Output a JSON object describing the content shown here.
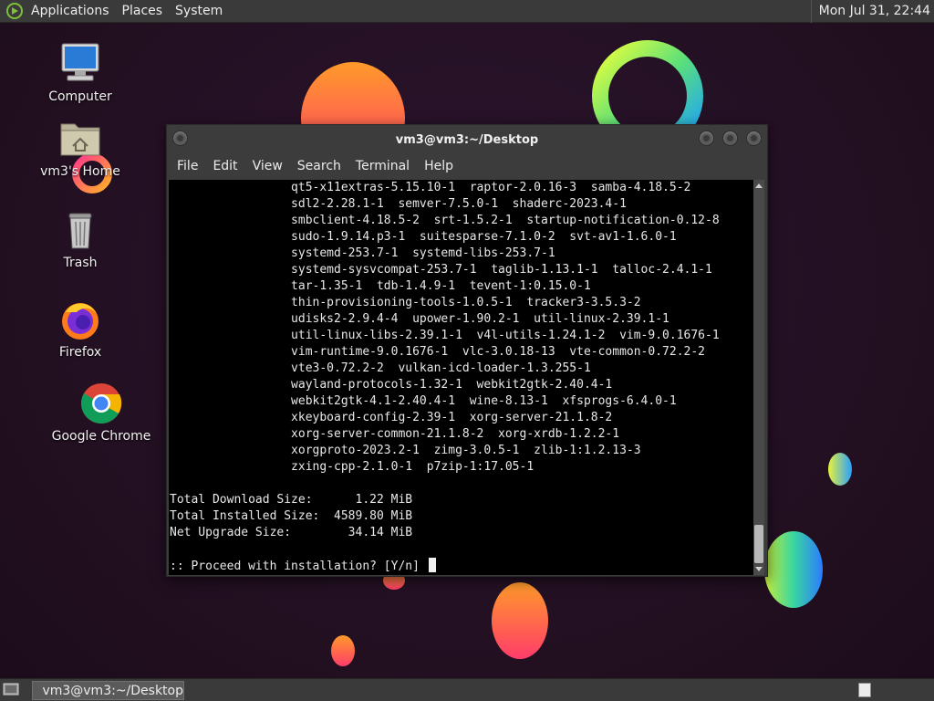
{
  "top_panel": {
    "menus": [
      "Applications",
      "Places",
      "System"
    ],
    "clock": "Mon Jul 31, 22:44"
  },
  "desktop_icons": [
    {
      "label": "Computer",
      "icon": "computer-icon"
    },
    {
      "label": "vm3's Home",
      "icon": "home-folder-icon"
    },
    {
      "label": "Trash",
      "icon": "trash-icon"
    },
    {
      "label": "Firefox",
      "icon": "firefox-icon"
    },
    {
      "label": "Google Chrome",
      "icon": "chrome-icon"
    }
  ],
  "terminal": {
    "title": "vm3@vm3:~/Desktop",
    "menu": [
      "File",
      "Edit",
      "View",
      "Search",
      "Terminal",
      "Help"
    ],
    "lines": [
      "                 qt5-x11extras-5.15.10-1  raptor-2.0.16-3  samba-4.18.5-2",
      "                 sdl2-2.28.1-1  semver-7.5.0-1  shaderc-2023.4-1",
      "                 smbclient-4.18.5-2  srt-1.5.2-1  startup-notification-0.12-8",
      "                 sudo-1.9.14.p3-1  suitesparse-7.1.0-2  svt-av1-1.6.0-1",
      "                 systemd-253.7-1  systemd-libs-253.7-1",
      "                 systemd-sysvcompat-253.7-1  taglib-1.13.1-1  talloc-2.4.1-1",
      "                 tar-1.35-1  tdb-1.4.9-1  tevent-1:0.15.0-1",
      "                 thin-provisioning-tools-1.0.5-1  tracker3-3.5.3-2",
      "                 udisks2-2.9.4-4  upower-1.90.2-1  util-linux-2.39.1-1",
      "                 util-linux-libs-2.39.1-1  v4l-utils-1.24.1-2  vim-9.0.1676-1",
      "                 vim-runtime-9.0.1676-1  vlc-3.0.18-13  vte-common-0.72.2-2",
      "                 vte3-0.72.2-2  vulkan-icd-loader-1.3.255-1",
      "                 wayland-protocols-1.32-1  webkit2gtk-2.40.4-1",
      "                 webkit2gtk-4.1-2.40.4-1  wine-8.13-1  xfsprogs-6.4.0-1",
      "                 xkeyboard-config-2.39-1  xorg-server-21.1.8-2",
      "                 xorg-server-common-21.1.8-2  xorg-xrdb-1.2.2-1",
      "                 xorgproto-2023.2-1  zimg-3.0.5-1  zlib-1:1.2.13-3",
      "                 zxing-cpp-2.1.0-1  p7zip-1:17.05-1",
      "",
      "Total Download Size:      1.22 MiB",
      "Total Installed Size:  4589.80 MiB",
      "Net Upgrade Size:        34.14 MiB",
      ""
    ],
    "prompt": ":: Proceed with installation? [Y/n] "
  },
  "taskbar": {
    "window_label": "vm3@vm3:~/Desktop"
  }
}
